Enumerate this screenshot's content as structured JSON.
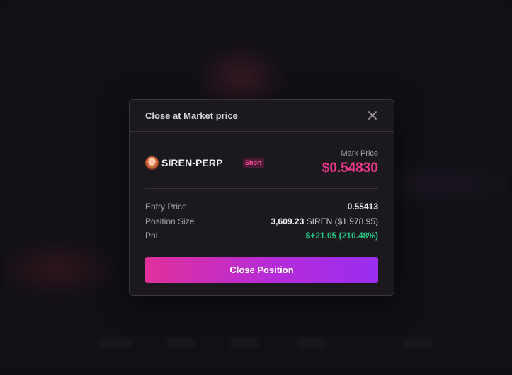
{
  "modal": {
    "title": "Close at Market price"
  },
  "market": {
    "name": "SIREN-PERP",
    "side": "Short",
    "mark_price_label": "Mark Price",
    "mark_price": "$0.54830"
  },
  "details": {
    "entry_price_label": "Entry Price",
    "entry_price": "0.55413",
    "position_size_label": "Position Size",
    "position_size_amount": "3,609.23",
    "position_size_unit": "SIREN ($1,978.95)",
    "pnl_label": "PnL",
    "pnl": "$+21.05 (210.48%)"
  },
  "actions": {
    "close_position_label": "Close Position"
  },
  "icons": {
    "close": "close-icon",
    "avatar": "token-avatar"
  },
  "colors": {
    "mark_price": "#f03a8c",
    "short_badge": "#ff4f9a",
    "pnl_positive": "#22c983",
    "button_gradient_start": "#e0309b",
    "button_gradient_end": "#9a2ef0"
  }
}
